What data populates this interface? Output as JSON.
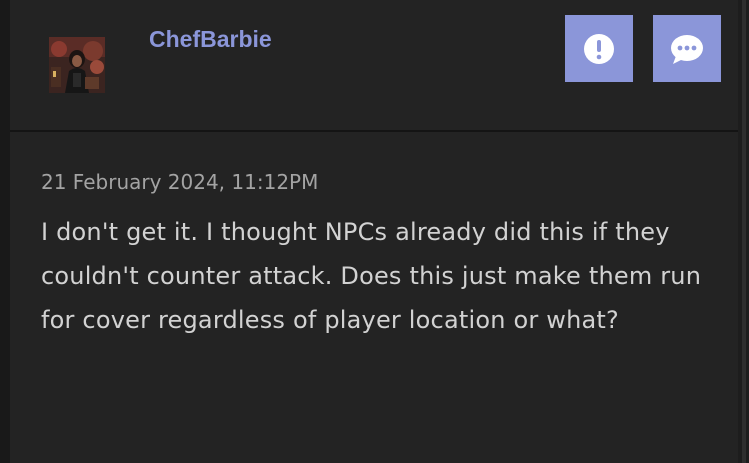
{
  "post": {
    "author": "ChefBarbie",
    "timestamp": "21 February 2024, 11:12PM",
    "body": "I don't get it. I thought NPCs already did this if they couldn't counter attack. Does this just make them run for cover regardless of player location or what?"
  },
  "actions": {
    "report_icon": "exclamation-circle-icon",
    "reply_icon": "chat-bubble-icon"
  },
  "colors": {
    "accent": "#8b96d9",
    "card_background": "#232323",
    "text": "#d2d2d2",
    "muted_text": "#a3a3a3"
  }
}
